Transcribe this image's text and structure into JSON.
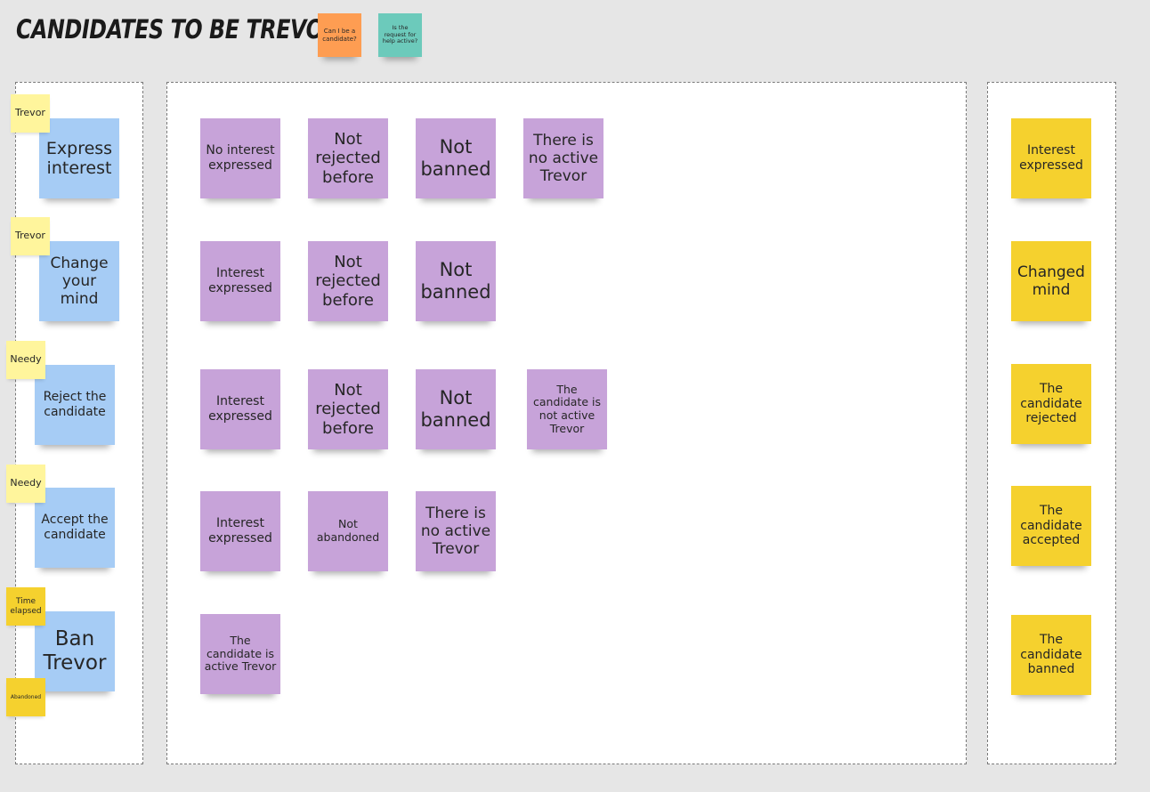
{
  "title": "CANDIDATES TO BE TREVOR",
  "legend": {
    "orange": "Can I be a candidate?",
    "teal": "Is the request for help active?"
  },
  "commands": [
    {
      "label": "Express interest",
      "actor": "Trevor"
    },
    {
      "label": "Change your mind",
      "actor": "Trevor"
    },
    {
      "label": "Reject the candidate",
      "actor": "Needy"
    },
    {
      "label": "Accept the candidate",
      "actor": "Needy"
    },
    {
      "label": "Ban Trevor",
      "actor": "Time elapsed",
      "actor2": "Abandoned"
    }
  ],
  "rules": [
    [
      "No interest expressed",
      "Not rejected before",
      "Not banned",
      "There is no active Trevor"
    ],
    [
      "Interest expressed",
      "Not rejected before",
      "Not banned"
    ],
    [
      "Interest expressed",
      "Not rejected before",
      "Not banned",
      "The candidate is not active Trevor"
    ],
    [
      "Interest expressed",
      "Not abandoned",
      "There is no active Trevor"
    ],
    [
      "The candidate is active Trevor"
    ]
  ],
  "events": [
    "Interest expressed",
    "Changed mind",
    "The candidate rejected",
    "The candidate accepted",
    "The candidate banned"
  ],
  "colors": {
    "background": "#e6e6e6",
    "command": "#a6ccf5",
    "rule": "#c7a3d9",
    "event": "#f5d12e",
    "actor": "#fff59c",
    "legend_orange": "#fe9d52",
    "legend_teal": "#6ccabb"
  }
}
